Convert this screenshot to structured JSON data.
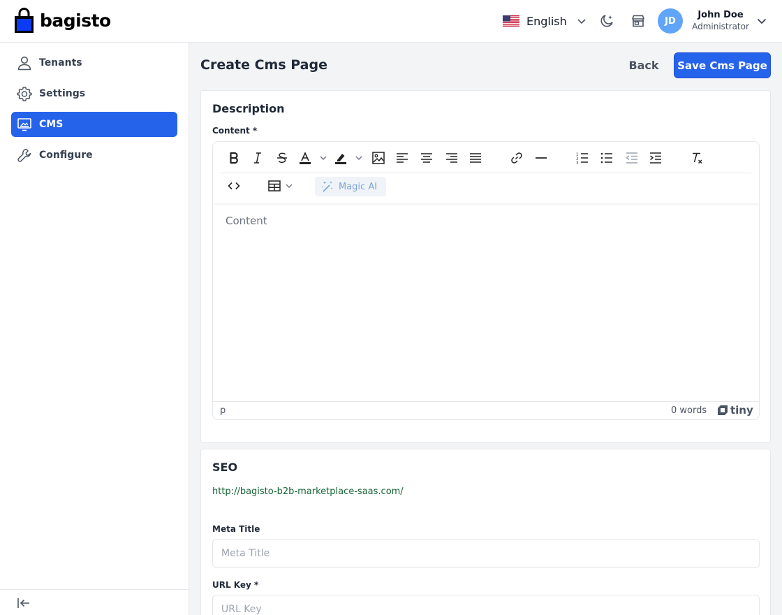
{
  "app": {
    "logo_text": "bagisto"
  },
  "header": {
    "language": "English",
    "user_initials": "JD",
    "user_name": "John Doe",
    "user_role": "Administrator"
  },
  "sidebar": {
    "items": [
      {
        "label": "Tenants",
        "icon": "user-icon",
        "active": false
      },
      {
        "label": "Settings",
        "icon": "gear-icon",
        "active": false
      },
      {
        "label": "CMS",
        "icon": "monitor-icon",
        "active": true
      },
      {
        "label": "Configure",
        "icon": "wrench-icon",
        "active": false
      }
    ]
  },
  "page": {
    "title": "Create Cms Page",
    "back_label": "Back",
    "save_label": "Save Cms Page"
  },
  "description": {
    "title": "Description",
    "content_label": "Content *",
    "editor": {
      "magic_ai_label": "Magic AI",
      "placeholder": "Content",
      "status_path": "p",
      "word_count": "0 words",
      "brand": "tiny"
    }
  },
  "seo": {
    "title": "SEO",
    "url": "http://bagisto-b2b-marketplace-saas.com/",
    "meta_title_label": "Meta Title",
    "meta_title_placeholder": "Meta Title",
    "url_key_label": "URL Key *",
    "url_key_placeholder": "URL Key"
  },
  "colors": {
    "accent": "#2563eb",
    "avatar": "#60a5fa",
    "seo_url": "#166534"
  }
}
